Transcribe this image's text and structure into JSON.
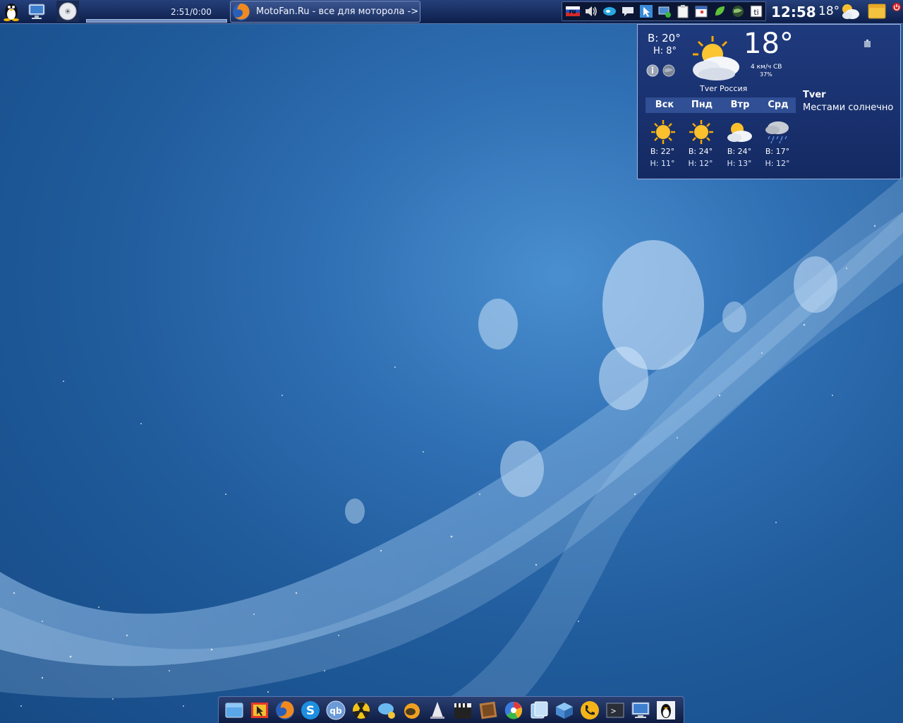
{
  "top_panel": {
    "player_time": "2:51/0:00",
    "task_firefox_label": "MotoFan.Ru - все для моторола ->",
    "lang_flag": "ru",
    "clock": "12:58",
    "panel_temp": "18°"
  },
  "weather": {
    "high": "В: 20°",
    "low": "Н: 8°",
    "temp": "18°",
    "wind": "4 км/ч СВ",
    "humidity": "37%",
    "location": "Tver Россия",
    "city": "Tver",
    "description": "Местами солнечно",
    "forecast": [
      {
        "day": "Вск",
        "high": "В: 22°",
        "low": "Н: 11°",
        "icon": "sun-icon"
      },
      {
        "day": "Пнд",
        "high": "В: 24°",
        "low": "Н: 12°",
        "icon": "sun-icon"
      },
      {
        "day": "Втр",
        "high": "В: 24°",
        "low": "Н: 13°",
        "icon": "partly-cloudy-icon"
      },
      {
        "day": "Срд",
        "high": "В: 17°",
        "low": "Н: 12°",
        "icon": "rain-cloud-icon"
      }
    ]
  },
  "dock": {
    "items": [
      "file-manager-icon",
      "presentation-icon",
      "firefox-icon",
      "skype-icon",
      "qbittorrent-icon",
      "radiation-icon",
      "chat-icon",
      "gimp-icon",
      "vlc-icon",
      "clapper-icon",
      "photo-icon",
      "picasa-icon",
      "phone-icon",
      "packages-icon",
      "call-icon",
      "terminal-icon",
      "monitor-icon",
      "tux-icon"
    ]
  },
  "colors": {
    "panel": "#0d1f4a",
    "widget": "#1f3a7d",
    "wallpaper": "#2f6fb3"
  }
}
